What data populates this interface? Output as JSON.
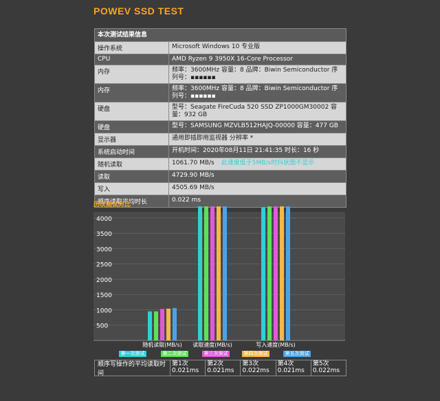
{
  "title": "POWEV SSD TEST",
  "info": {
    "header": "本次测试结果信息",
    "rows": [
      {
        "k": "操作系统",
        "v": "Microsoft Windows 10 专业版",
        "style": "light"
      },
      {
        "k": "CPU",
        "v": "AMD Ryzen 9 3950X 16-Core Processor",
        "style": "dark"
      },
      {
        "k": "内存",
        "v": "频率：3600MHz    容量：8    品牌：Biwin Semiconductor    序列号：▪▪▪▪▪▪",
        "style": "light"
      },
      {
        "k": "内存",
        "v": "频率：3600MHz    容量：8    品牌：Biwin Semiconductor    序列号：▪▪▪▪▪▪",
        "style": "dark"
      },
      {
        "k": "硬盘",
        "v": "型号：Seagate FireCuda 520 SSD ZP1000GM30002    容量：932 GB",
        "style": "light"
      },
      {
        "k": "硬盘",
        "v": "型号：SAMSUNG MZVLB512HAJQ-00000    容量：477 GB",
        "style": "dark"
      },
      {
        "k": "显示器",
        "v": "通用即插即用监视器 分辨率 *",
        "style": "light"
      },
      {
        "k": "系统启动时间",
        "v": "开机时间：2020年08月11日 21:41:35 时长：16 秒",
        "style": "dark"
      },
      {
        "k": "随机读取",
        "v": "1061.70 MB/s",
        "note": "此速度低于5MB/s时抖状图不显示",
        "style": "light"
      },
      {
        "k": "读取",
        "v": "4729.90 MB/s",
        "style": "dark"
      },
      {
        "k": "写入",
        "v": "4505.69 MB/s",
        "style": "light"
      },
      {
        "k": "顺序读取平均时长",
        "v": "0.022 ms",
        "style": "dark"
      }
    ]
  },
  "history_title": "历次测试对比",
  "chart_data": {
    "type": "bar",
    "categories": [
      "随机读取(MB/s)",
      "读取速度(MB/s)",
      "写入速度(MB/s)"
    ],
    "yticks": [
      500,
      1000,
      1500,
      2000,
      2500,
      3000,
      3500,
      4000
    ],
    "ylim": [
      0,
      4200
    ],
    "series": [
      {
        "name": "第一次测试",
        "color": "#2fd0d8",
        "values": [
          950,
          4550,
          4350
        ]
      },
      {
        "name": "第二次测试",
        "color": "#5ee05a",
        "values": [
          950,
          4750,
          4380
        ]
      },
      {
        "name": "第三次测试",
        "color": "#e05ad8",
        "values": [
          1030,
          4750,
          4420
        ]
      },
      {
        "name": "第四次测试",
        "color": "#f5b84a",
        "values": [
          1040,
          4750,
          4420
        ]
      },
      {
        "name": "第五次测试",
        "color": "#4aa3e8",
        "values": [
          1060,
          4730,
          4400
        ]
      }
    ]
  },
  "bottom": {
    "label": "顺序写操作的平均读取时间",
    "cells": [
      {
        "n": "第1次",
        "v": "0.021ms"
      },
      {
        "n": "第2次",
        "v": "0.021ms"
      },
      {
        "n": "第3次",
        "v": "0.022ms"
      },
      {
        "n": "第4次",
        "v": "0.021ms"
      },
      {
        "n": "第5次",
        "v": "0.022ms"
      }
    ]
  }
}
